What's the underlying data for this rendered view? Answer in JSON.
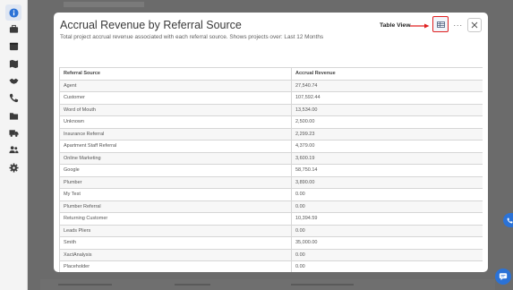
{
  "sidebar": {
    "items": [
      {
        "name": "info",
        "icon": "info-icon",
        "active": true
      },
      {
        "name": "jobs",
        "icon": "briefcase-icon"
      },
      {
        "name": "calendar",
        "icon": "calendar-icon"
      },
      {
        "name": "map",
        "icon": "map-icon"
      },
      {
        "name": "team",
        "icon": "handshake-icon"
      },
      {
        "name": "calls",
        "icon": "phone-icon"
      },
      {
        "name": "documents",
        "icon": "folder-icon"
      },
      {
        "name": "fleet",
        "icon": "truck-icon"
      },
      {
        "name": "users",
        "icon": "users-icon"
      },
      {
        "name": "settings",
        "icon": "gear-icon"
      }
    ]
  },
  "modal": {
    "title": "Accrual Revenue by Referral Source",
    "subtitle": "Total project accrual revenue associated with each referral source. Shows projects over: Last 12 Months",
    "annotation_label": "Table View",
    "table_view_icon": "table-view-icon",
    "more_icon": "more-options-icon",
    "more_label": "···",
    "close_icon": "close-icon"
  },
  "table": {
    "headers": [
      "Referral Source",
      "Accrual Revenue"
    ],
    "rows": [
      [
        "Agent",
        "27,540.74"
      ],
      [
        "Customer",
        "107,592.44"
      ],
      [
        "Word of Mouth",
        "13,534.00"
      ],
      [
        "Unknown",
        "2,500.00"
      ],
      [
        "Insurance Referral",
        "2,299.23"
      ],
      [
        "Apartment Staff Referral",
        "4,379.00"
      ],
      [
        "Online Marketing",
        "3,600.19"
      ],
      [
        "Google",
        "58,750.14"
      ],
      [
        "Plumber",
        "3,890.00"
      ],
      [
        "My Test",
        "0.00"
      ],
      [
        "Plumber Referral",
        "0.00"
      ],
      [
        "Returning Customer",
        "10,394.59"
      ],
      [
        "Leads Pliers",
        "0.00"
      ],
      [
        "Smith",
        "35,000.00"
      ],
      [
        "XactAnalysis",
        "0.00"
      ],
      [
        "Placeholder",
        "0.00"
      ]
    ]
  },
  "colors": {
    "accent": "#2b72d6",
    "annotation_red": "#e02020",
    "overlay": "#5b5b5b"
  },
  "fab": {
    "chat_icon": "chat-icon",
    "phone_icon": "phone-icon"
  }
}
